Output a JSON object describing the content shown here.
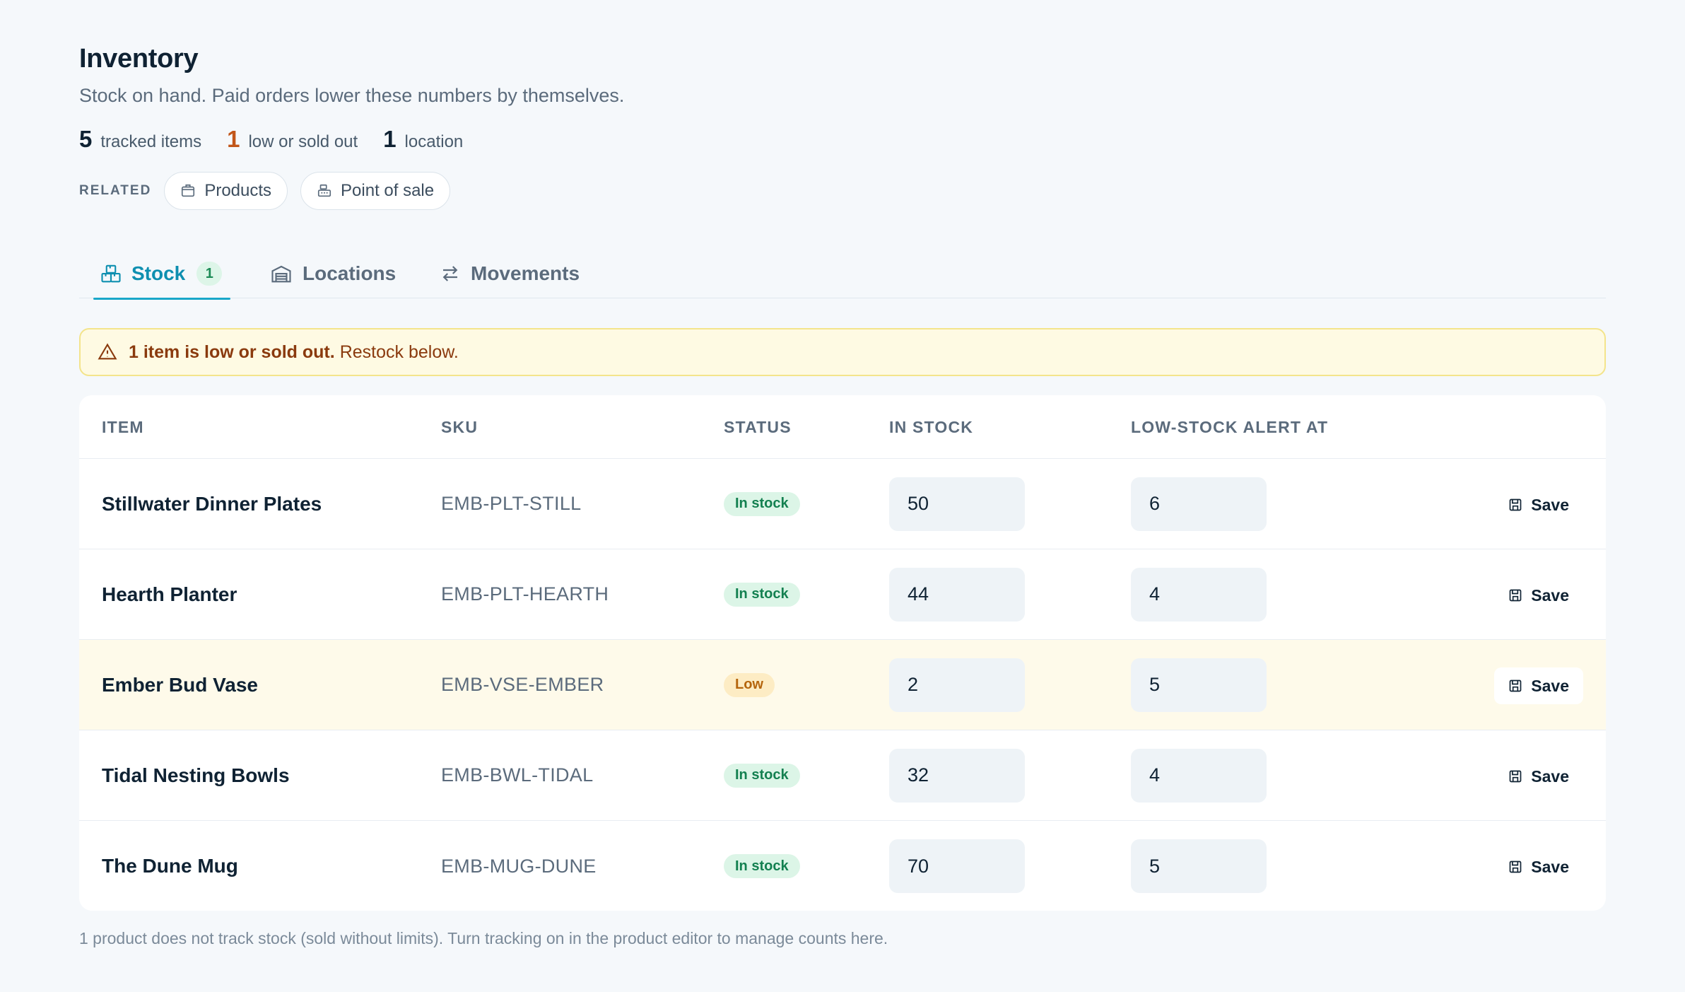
{
  "header": {
    "title": "Inventory",
    "subtitle": "Stock on hand. Paid orders lower these numbers by themselves."
  },
  "stats": [
    {
      "value": "5",
      "label": "tracked items"
    },
    {
      "value": "1",
      "label": "low or sold out"
    },
    {
      "value": "1",
      "label": "location"
    }
  ],
  "related": {
    "label": "RELATED",
    "links": [
      {
        "label": "Products",
        "icon": "box-icon"
      },
      {
        "label": "Point of sale",
        "icon": "register-icon"
      }
    ]
  },
  "tabs": [
    {
      "label": "Stock",
      "badge": "1",
      "active": true,
      "icon": "boxes-icon"
    },
    {
      "label": "Locations",
      "active": false,
      "icon": "warehouse-icon"
    },
    {
      "label": "Movements",
      "active": false,
      "icon": "arrows-swap-icon"
    }
  ],
  "alert": {
    "strong": "1 item is low or sold out.",
    "text": "Restock below.",
    "icon": "warning-triangle-icon"
  },
  "table": {
    "columns": [
      "ITEM",
      "SKU",
      "STATUS",
      "IN STOCK",
      "LOW-STOCK ALERT AT"
    ],
    "save_label": "Save",
    "rows": [
      {
        "item": "Stillwater Dinner Plates",
        "sku": "EMB-PLT-STILL",
        "status": "In stock",
        "in_stock": "50",
        "alert_at": "6"
      },
      {
        "item": "Hearth Planter",
        "sku": "EMB-PLT-HEARTH",
        "status": "In stock",
        "in_stock": "44",
        "alert_at": "4"
      },
      {
        "item": "Ember Bud Vase",
        "sku": "EMB-VSE-EMBER",
        "status": "Low",
        "in_stock": "2",
        "alert_at": "5"
      },
      {
        "item": "Tidal Nesting Bowls",
        "sku": "EMB-BWL-TIDAL",
        "status": "In stock",
        "in_stock": "32",
        "alert_at": "4"
      },
      {
        "item": "The Dune Mug",
        "sku": "EMB-MUG-DUNE",
        "status": "In stock",
        "in_stock": "70",
        "alert_at": "5"
      }
    ]
  },
  "footnote": "1 product does not track stock (sold without limits). Turn tracking on in the product editor to manage counts here.",
  "colors": {
    "accent": "#0e8fb0",
    "warning": "#c2561a",
    "success_bg": "#dcf5e7",
    "low_row_bg": "#fefaea"
  }
}
